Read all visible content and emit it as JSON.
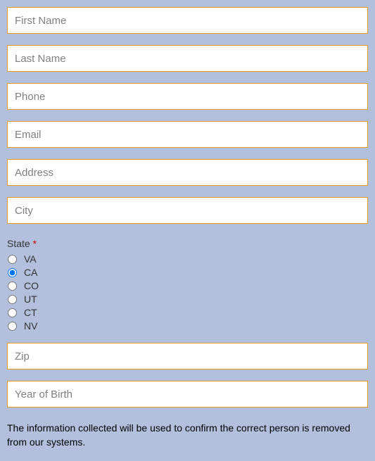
{
  "fields": {
    "first_name": {
      "placeholder": "First Name",
      "value": ""
    },
    "last_name": {
      "placeholder": "Last Name",
      "value": ""
    },
    "phone": {
      "placeholder": "Phone",
      "value": ""
    },
    "email": {
      "placeholder": "Email",
      "value": ""
    },
    "address": {
      "placeholder": "Address",
      "value": ""
    },
    "city": {
      "placeholder": "City",
      "value": ""
    },
    "zip": {
      "placeholder": "Zip",
      "value": ""
    },
    "year_of_birth": {
      "placeholder": "Year of Birth",
      "value": ""
    }
  },
  "state": {
    "label": "State",
    "required_marker": "*",
    "selected": "CA",
    "options": [
      "VA",
      "CA",
      "CO",
      "UT",
      "CT",
      "NV"
    ]
  },
  "disclaimer": "The information collected will be used to confirm the correct person is removed from our systems."
}
